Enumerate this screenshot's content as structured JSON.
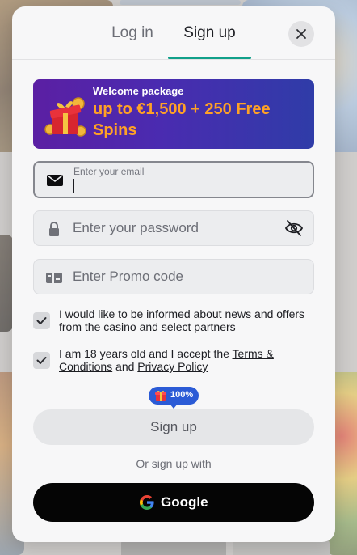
{
  "tabs": [
    {
      "label": "Log in",
      "active": false
    },
    {
      "label": "Sign up",
      "active": true
    }
  ],
  "colors": {
    "accent": "#11a08a",
    "offer": "#ffa126",
    "pill": "#2b5bd6"
  },
  "icons": {
    "close": "close-icon",
    "gift": "gift-icon",
    "email": "envelope-icon",
    "password": "lock-icon",
    "visibility": "eye-off-icon",
    "promo": "ticket-icon",
    "check": "checkmark-icon",
    "google": "google-icon"
  },
  "banner": {
    "kicker": "Welcome package",
    "offer": "up to €1,500 + 250 Free Spins"
  },
  "form": {
    "email": {
      "label": "Enter your email",
      "value": ""
    },
    "password": {
      "placeholder": "Enter your password",
      "value": ""
    },
    "promo": {
      "placeholder": "Enter Promo code",
      "value": ""
    },
    "consents": [
      {
        "checked": true,
        "text": "I would like to be informed about news and offers from the casino and select partners"
      },
      {
        "checked": true,
        "text_before": "I am 18 years old and I accept the ",
        "terms_link": "Terms & Conditions",
        "text_middle": " and ",
        "privacy_link": "Privacy Policy"
      }
    ],
    "progress": {
      "label": "100%",
      "value": 1.0
    },
    "submit_label": "Sign up"
  },
  "alt_signup": {
    "divider_text": "Or sign up with",
    "google_label": "Google"
  }
}
